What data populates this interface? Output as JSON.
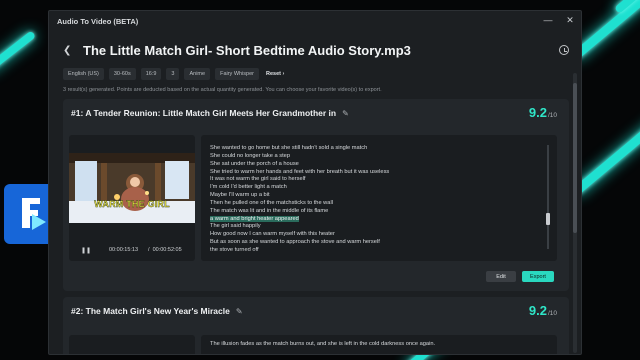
{
  "app": {
    "window_title": "Audio To Video (BETA)"
  },
  "header": {
    "title": "The Little Match Girl- Short Bedtime Audio Story.mp3"
  },
  "tags": [
    "English (US)",
    "30-60s",
    "16:9",
    "3",
    "Anime",
    "Fairy Whisper"
  ],
  "reset_label": "Reset",
  "info_text": "3 result(s) generated. Points are deducted based on the actual quantity generated. You can choose your favorite video(s) to export.",
  "results": [
    {
      "heading": "#1:  A Tender Reunion: Little Match Girl Meets Her Grandmother in",
      "score": "9.2",
      "score_suffix": "/10",
      "thumbnail_caption": "WARM THE GIRL",
      "current_time": "00:00:15:13",
      "separator": "/",
      "total_time": "00:00:52:05",
      "transcript": [
        "She wanted to go home but she still hadn't sold a single match",
        "She could no longer take a step",
        "She sat under the porch of a house",
        "She tried to warm her hands and feet with her breath but it was useless",
        "It was not warm the girl said to herself",
        "I'm cold I'd better light a match",
        "Maybe I'll warm up a bit",
        "Then he pulled one of the matchsticks to the wall",
        "The match was lit and in the middle of its flame",
        "a warm and bright heater appeared",
        "The girl said happily",
        "How good now I can warm myself with this heater",
        "But as soon as she wanted to approach the stove and warm herself",
        "the stove turned off"
      ],
      "highlighted_index": 9,
      "edit_label": "Edit",
      "export_label": "Export"
    },
    {
      "heading": "#2:  The Match Girl's New Year's Miracle",
      "score": "9.2",
      "score_suffix": "/10",
      "transcript_first": "The illusion fades as the match burns out, and she is left in the cold darkness once again."
    }
  ],
  "colors": {
    "accent": "#2fe6c8",
    "export": "#2ad8bf",
    "highlight": "#2a6b5c",
    "caption": "#f6e94a",
    "neon": "#1fe0d0"
  },
  "icons": [
    "close-icon",
    "minimize-icon",
    "back-icon",
    "history-icon",
    "pencil-icon",
    "pause-icon",
    "chevron-right-icon"
  ]
}
